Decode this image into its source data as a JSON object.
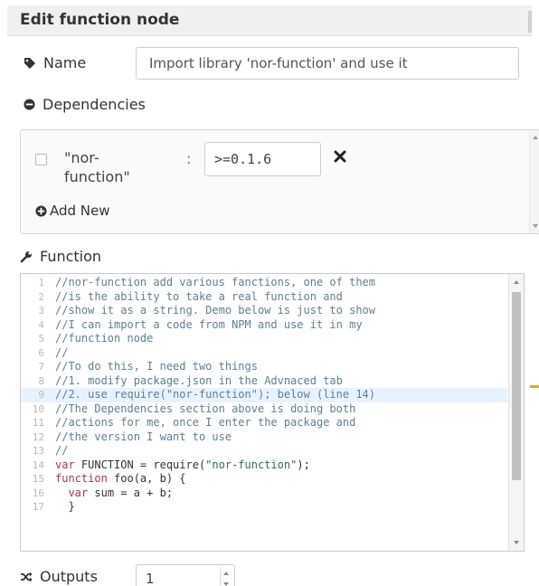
{
  "dialog": {
    "title": "Edit function node"
  },
  "name": {
    "label": "Name",
    "value": "Import library 'nor-function' and use it"
  },
  "dependencies": {
    "label": "Dependencies",
    "items": [
      {
        "package": "\"nor-function\"",
        "separator": ":",
        "version": ">=0.1.6"
      }
    ],
    "add_label": "Add New"
  },
  "function": {
    "label": "Function",
    "active_line": 9,
    "lines": [
      {
        "n": "1",
        "tokens": [
          {
            "t": "comment",
            "v": "//nor-function add various fanctions, one of them"
          }
        ]
      },
      {
        "n": "2",
        "tokens": [
          {
            "t": "comment",
            "v": "//is the ability to take a real function and"
          }
        ]
      },
      {
        "n": "3",
        "tokens": [
          {
            "t": "comment",
            "v": "//show it as a string. Demo below is just to show"
          }
        ]
      },
      {
        "n": "4",
        "tokens": [
          {
            "t": "comment",
            "v": "//I can import a code from NPM and use it in my"
          }
        ]
      },
      {
        "n": "5",
        "tokens": [
          {
            "t": "comment",
            "v": "//function node"
          }
        ]
      },
      {
        "n": "6",
        "tokens": [
          {
            "t": "comment",
            "v": "//"
          }
        ]
      },
      {
        "n": "7",
        "tokens": [
          {
            "t": "comment",
            "v": "//To do this, I need two things"
          }
        ]
      },
      {
        "n": "8",
        "tokens": [
          {
            "t": "comment",
            "v": "//1. modify package.json in the Advnaced tab"
          }
        ]
      },
      {
        "n": "9",
        "tokens": [
          {
            "t": "comment",
            "v": "//2. use require(\"nor-function\"); below (line 14)"
          }
        ]
      },
      {
        "n": "10",
        "tokens": [
          {
            "t": "comment",
            "v": "//The Dependencies section above is doing both"
          }
        ]
      },
      {
        "n": "11",
        "tokens": [
          {
            "t": "comment",
            "v": "//actions for me, once I enter the package and"
          }
        ]
      },
      {
        "n": "12",
        "tokens": [
          {
            "t": "comment",
            "v": "//the version I want to use"
          }
        ]
      },
      {
        "n": "13",
        "tokens": [
          {
            "t": "comment",
            "v": "//"
          }
        ]
      },
      {
        "n": "14",
        "tokens": [
          {
            "t": "keyword",
            "v": "var"
          },
          {
            "t": "plain",
            "v": " FUNCTION = require("
          },
          {
            "t": "string",
            "v": "\"nor-function\""
          },
          {
            "t": "plain",
            "v": ");"
          }
        ]
      },
      {
        "n": "15",
        "tokens": [
          {
            "t": "keyword",
            "v": "function"
          },
          {
            "t": "plain",
            "v": " foo(a, b) {"
          }
        ]
      },
      {
        "n": "16",
        "tokens": [
          {
            "t": "plain",
            "v": "  "
          },
          {
            "t": "keyword",
            "v": "var"
          },
          {
            "t": "plain",
            "v": " sum = a + b;"
          }
        ]
      },
      {
        "n": "17",
        "tokens": [
          {
            "t": "plain",
            "v": "  }"
          }
        ]
      }
    ]
  },
  "outputs": {
    "label": "Outputs",
    "value": "1"
  }
}
